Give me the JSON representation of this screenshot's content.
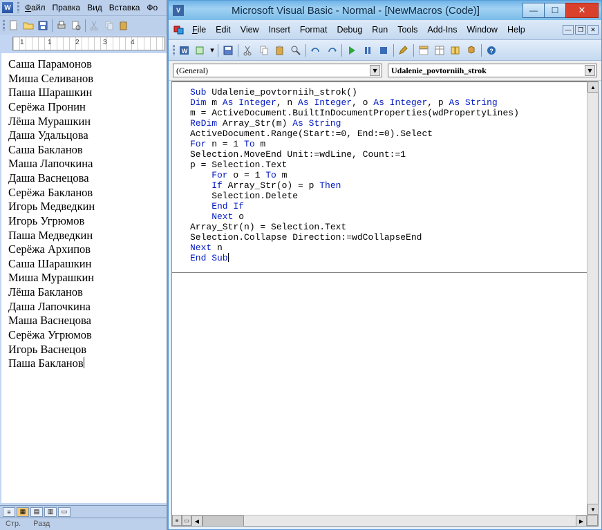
{
  "word": {
    "icon_letter": "W",
    "menu": {
      "file": "Файл",
      "edit": "Правка",
      "view": "Вид",
      "insert": "Вставка",
      "format_trunc": "Фо"
    },
    "ruler_numbers": [
      "1",
      "1",
      "2",
      "3",
      "4"
    ],
    "names": [
      "Саша Парамонов",
      "Миша Селиванов",
      "Паша Шарашкин",
      "Серёжа Пронин",
      "Лёша Мурашкин",
      "Даша Удальцова",
      "Саша Бакланов",
      "Маша Лапочкина",
      "Даша Васнецова",
      "Серёжа Бакланов",
      "Игорь Медведкин",
      "Игорь Угрюмов",
      "Паша Медведкин",
      "Серёжа Архипов",
      "Саша Шарашкин",
      "Миша Мурашкин",
      "Лёша Бакланов",
      "Даша Лапочкина",
      "Маша Васнецова",
      "Серёжа Угрюмов",
      "Игорь Васнецов",
      "Паша Бакланов"
    ],
    "status": {
      "page": "Стр.",
      "section": "Разд"
    }
  },
  "vb": {
    "sys_letter": "V",
    "title": "Microsoft Visual Basic - Normal - [NewMacros (Code)]",
    "menu": {
      "file": "File",
      "edit": "Edit",
      "view": "View",
      "insert": "Insert",
      "format": "Format",
      "debug": "Debug",
      "run": "Run",
      "tools": "Tools",
      "addins": "Add-Ins",
      "window": "Window",
      "help": "Help"
    },
    "combo_object": "(General)",
    "combo_proc": "Udalenie_povtorniih_strok",
    "code": {
      "l1a": "Sub",
      "l1b": " Udalenie_povtorniih_strok()",
      "l2a": "Dim",
      "l2b": " m ",
      "l2c": "As Integer",
      "l2d": ", n ",
      "l2e": "As Integer",
      "l2f": ", o ",
      "l2g": "As Integer",
      "l2h": ", p ",
      "l2i": "As String",
      "l3": "m = ActiveDocument.BuiltInDocumentProperties(wdPropertyLines)",
      "l4a": "ReDim",
      "l4b": " Array_Str(m) ",
      "l4c": "As String",
      "l5": "ActiveDocument.Range(Start:=0, End:=0).Select",
      "l6a": "For",
      "l6b": " n = 1 ",
      "l6c": "To",
      "l6d": " m",
      "l7": "Selection.MoveEnd Unit:=wdLine, Count:=1",
      "l8": "p = Selection.Text",
      "l9a": "    For",
      "l9b": " o = 1 ",
      "l9c": "To",
      "l9d": " m",
      "l10a": "    If",
      "l10b": " Array_Str(o) = p ",
      "l10c": "Then",
      "l11": "    Selection.Delete",
      "l12": "    End If",
      "l13a": "    Next",
      "l13b": " o",
      "l14": "Array_Str(n) = Selection.Text",
      "l15": "Selection.Collapse Direction:=wdCollapseEnd",
      "l16a": "Next",
      "l16b": " n",
      "l17": "End Sub"
    }
  }
}
